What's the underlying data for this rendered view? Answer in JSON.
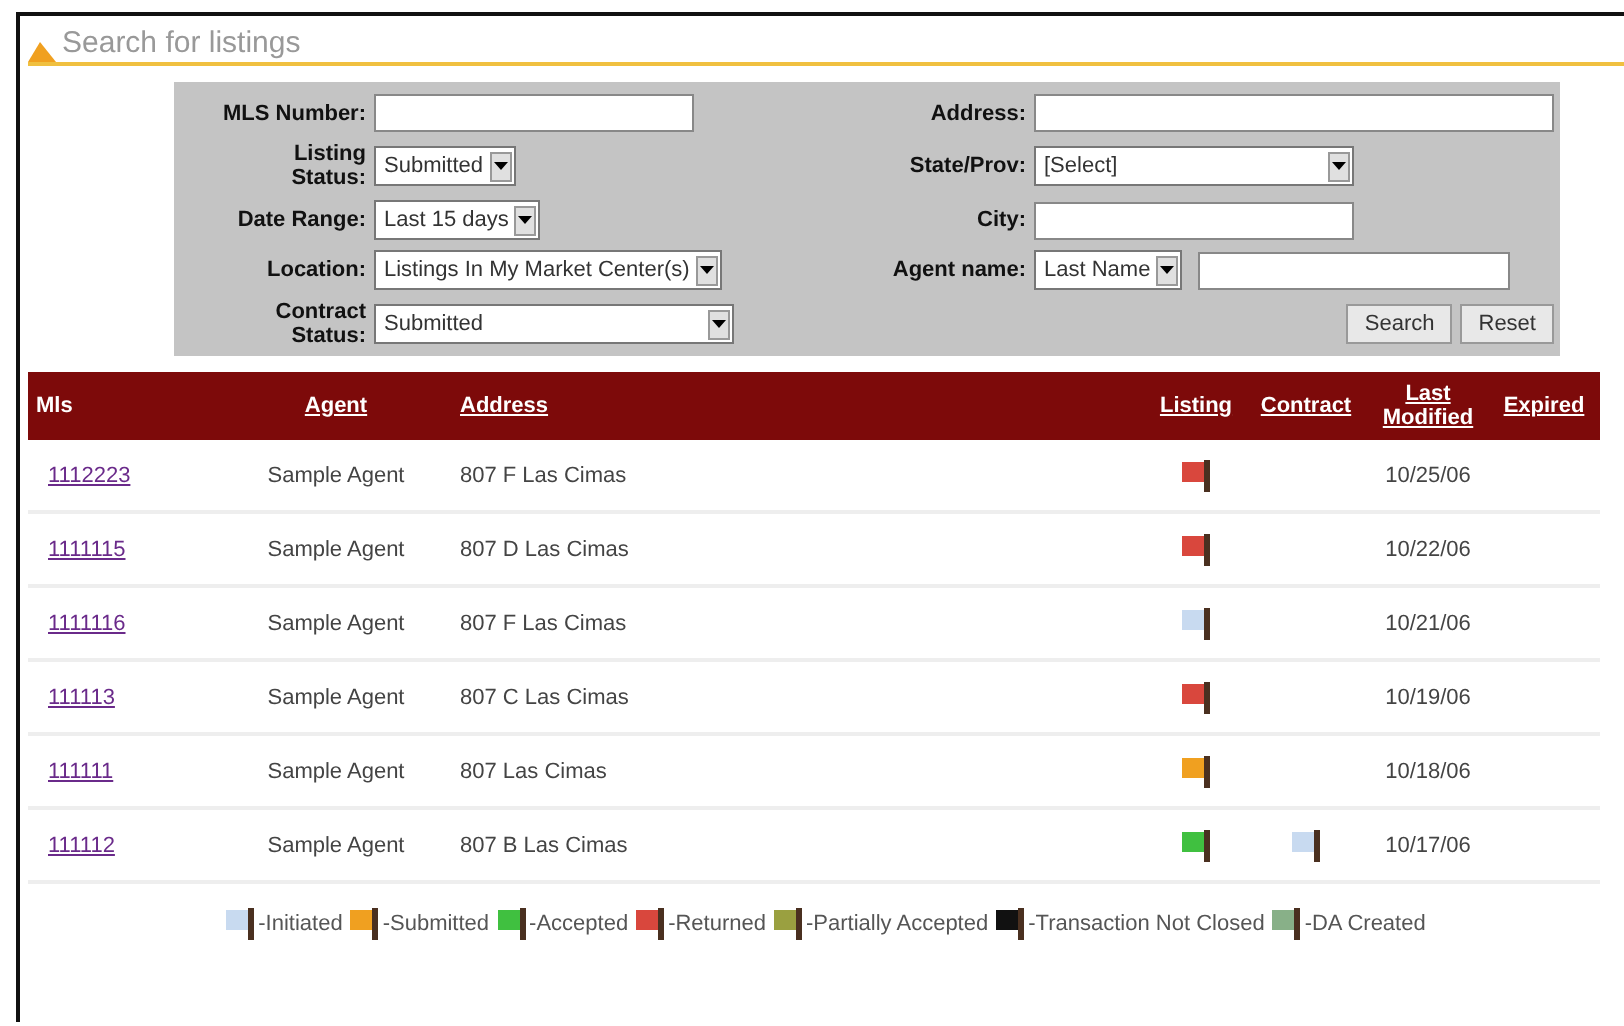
{
  "section_title": "Search for listings",
  "form": {
    "fields": [
      {
        "label": "MLS Number:",
        "kind": "text"
      },
      {
        "label": "Address:",
        "kind": "text"
      },
      {
        "label": "Listing Status:",
        "kind": "select",
        "value": "Submitted"
      },
      {
        "label": "State/Prov:",
        "kind": "select",
        "value": "[Select]"
      },
      {
        "label": "Date Range:",
        "kind": "select",
        "value": "Last 15 days"
      },
      {
        "label": "City:",
        "kind": "text"
      },
      {
        "label": "Location:",
        "kind": "select",
        "value": "Listings In My Market Center(s)"
      },
      {
        "label": "Agent name:",
        "kind": "select_text",
        "value": "Last Name"
      },
      {
        "label": "Contract Status:",
        "kind": "select",
        "value": "Submitted"
      }
    ],
    "buttons": [
      "Search",
      "Reset"
    ]
  },
  "table": {
    "columns": [
      {
        "label": "Mls",
        "link": false
      },
      {
        "label": "Agent",
        "link": true
      },
      {
        "label": "Address",
        "link": true
      },
      {
        "label": "Listing",
        "link": true
      },
      {
        "label": "Contract",
        "link": true
      },
      {
        "label": "Last Modified",
        "link": true
      },
      {
        "label": "Expired",
        "link": true
      }
    ],
    "rows": [
      {
        "mls": "1112223",
        "agent": "Sample Agent",
        "address": "807 F Las Cimas",
        "listing_flag": {
          "color": "#d9473d"
        },
        "last_modified": "10/25/06"
      },
      {
        "mls": "1111115",
        "agent": "Sample Agent",
        "address": "807 D Las Cimas",
        "listing_flag": {
          "color": "#d9473d"
        },
        "last_modified": "10/22/06"
      },
      {
        "mls": "1111116",
        "agent": "Sample Agent",
        "address": "807 F Las Cimas",
        "listing_flag": {
          "color": "#c8daf0"
        },
        "last_modified": "10/21/06"
      },
      {
        "mls": "111113",
        "agent": "Sample Agent",
        "address": "807 C Las Cimas",
        "listing_flag": {
          "color": "#d9473d"
        },
        "last_modified": "10/19/06"
      },
      {
        "mls": "111111",
        "agent": "Sample Agent",
        "address": "807 Las Cimas",
        "listing_flag": {
          "color": "#f0a020"
        },
        "last_modified": "10/18/06"
      },
      {
        "mls": "111112",
        "agent": "Sample Agent",
        "address": "807 B Las Cimas",
        "listing_flag": {
          "color": "#40c040"
        },
        "contract_flag": {
          "color": "#c8daf0"
        },
        "last_modified": "10/17/06"
      }
    ]
  },
  "legend": [
    {
      "label": "-Initiated",
      "color": "#c8daf0"
    },
    {
      "label": "-Submitted",
      "color": "#f0a020"
    },
    {
      "label": "-Accepted",
      "color": "#40c040"
    },
    {
      "label": "-Returned",
      "color": "#d9473d"
    },
    {
      "label": "-Partially Accepted",
      "color": "#9aa040"
    },
    {
      "label": "-Transaction Not Closed",
      "color": "#111111"
    },
    {
      "label": "-DA Created",
      "color": "#88b088"
    }
  ]
}
